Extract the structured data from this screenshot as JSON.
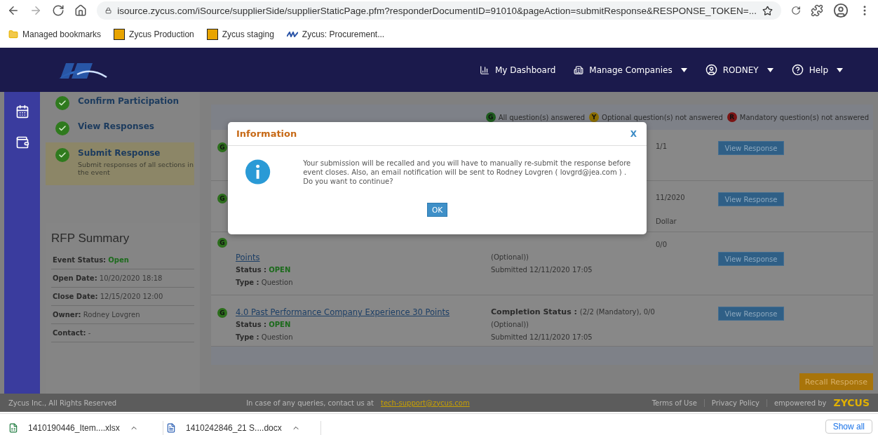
{
  "browser": {
    "url": "isource.zycus.com/iSource/supplierSide/supplierStaticPage.pfm?responderDocumentID=91010&pageAction=submitResponse&RESPONSE_TOKEN=...",
    "bookmarks": [
      {
        "label": "Managed bookmarks",
        "kind": "folder"
      },
      {
        "label": "Zycus Production",
        "kind": "z"
      },
      {
        "label": "Zycus staging",
        "kind": "z"
      },
      {
        "label": "Zycus: Procurement...",
        "kind": "jea"
      }
    ]
  },
  "header": {
    "nav": [
      {
        "label": "My Dashboard",
        "kind": "dashboard",
        "dropdown": false
      },
      {
        "label": "Manage Companies",
        "kind": "companies",
        "dropdown": true
      },
      {
        "label": "RODNEY",
        "kind": "user",
        "dropdown": true
      },
      {
        "label": "Help",
        "kind": "help",
        "dropdown": true
      }
    ]
  },
  "steps": [
    {
      "title": "Confirm Participation",
      "selected": false
    },
    {
      "title": "View Responses",
      "selected": false
    },
    {
      "title": "Submit Response",
      "description": "Submit responses of all sections in the event",
      "selected": true
    }
  ],
  "summary": {
    "title": "RFP Summary",
    "fields": [
      {
        "label": "Event Status:",
        "value": "Open",
        "kind": "status"
      },
      {
        "label": "Open Date:",
        "value": "10/20/2020 18:18",
        "kind": "plain"
      },
      {
        "label": "Close Date:",
        "value": "12/15/2020 12:00",
        "kind": "plain"
      },
      {
        "label": "Owner:",
        "value": "Rodney Lovgren",
        "kind": "plain"
      },
      {
        "label": "Contact:",
        "value": "-",
        "kind": "plain"
      }
    ]
  },
  "legend": [
    {
      "badge": "G",
      "text": "All question(s) answered",
      "color": "#1e5c1e"
    },
    {
      "badge": "Y",
      "text": "Optional question(s) not answered",
      "color": "#8a6d00"
    },
    {
      "badge": "R",
      "text": "Mandatory question(s) not answered",
      "color": "#7a1414"
    }
  ],
  "rows": [
    {
      "kind": "covered_top",
      "badge": "G",
      "completion": [
        {
          "kind": "fragment",
          "value": "1/1"
        }
      ],
      "button": "View Response"
    },
    {
      "kind": "covered_top",
      "badge": "G",
      "completion": [
        {
          "kind": "fragment",
          "value": "11/2020"
        },
        {
          "kind": "fragment_low",
          "value": "Dollar"
        }
      ],
      "button": "View Response"
    },
    {
      "kind": "covered_title",
      "badge": "G",
      "title": "Points",
      "status_label": "Status :",
      "status": "OPEN",
      "type_label": "Type :",
      "type": "Question",
      "completion": [
        {
          "kind": "fragment",
          "value": "0/0"
        },
        {
          "kind": "line",
          "value": "(Optional))"
        },
        {
          "kind": "line",
          "value": "Submitted 12/11/2020 17:05"
        }
      ],
      "button": "View Response"
    },
    {
      "kind": "full",
      "badge": "G",
      "title": "4.0 Past Performance Company Experience 30 Points",
      "status_label": "Status :",
      "status": "OPEN",
      "type_label": "Type :",
      "type": "Question",
      "completion": [
        {
          "kind": "head",
          "label": "Completion Status :",
          "value": "(2/2 (Mandatory), 0/0"
        },
        {
          "kind": "line",
          "value": "(Optional))"
        },
        {
          "kind": "line",
          "value": "Submitted 12/11/2020 17:05"
        }
      ],
      "button": "View Response"
    }
  ],
  "recall_button": "Recall Response",
  "modal": {
    "title": "Information",
    "close": "X",
    "message": "Your submission will be recalled and you will have to manually re-submit the response before event closes. Also, an email notification will be sent to Rodney Lovgren ( lovgrd@jea.com ) . Do you want to continue?",
    "ok": "OK"
  },
  "footer": {
    "copyright": "Zycus Inc., All Rights Reserved",
    "contact": "In case of any queries, contact us at",
    "email": "tech-support@zycus.com",
    "links": [
      "Terms of Use",
      "Privacy Policy"
    ],
    "empowered": "empowered by",
    "brand": "ZYCUS"
  },
  "downloads": {
    "files": [
      {
        "name": "1410190446_Item....xlsx",
        "kind": "xlsx"
      },
      {
        "name": "1410242846_21 S....docx",
        "kind": "docx"
      }
    ],
    "show_all": "Show all"
  }
}
